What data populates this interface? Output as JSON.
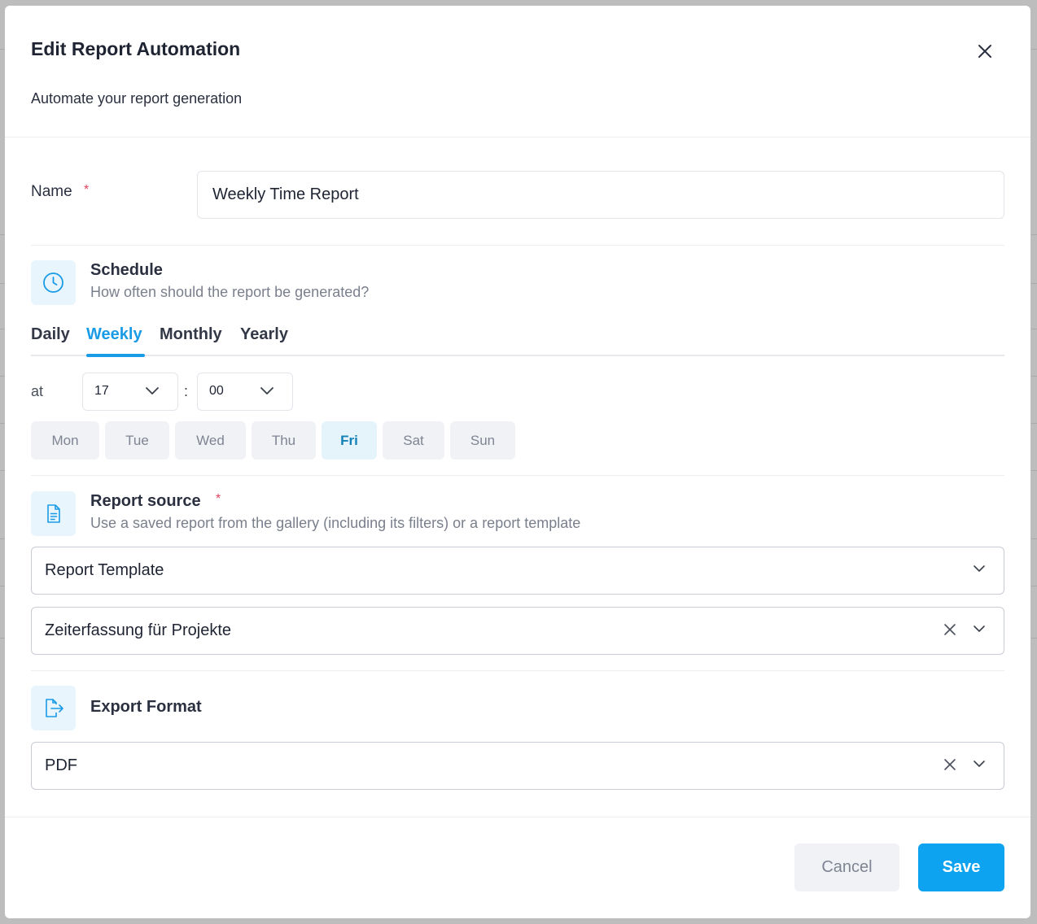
{
  "dialog": {
    "title": "Edit Report Automation",
    "subtitle": "Automate your report generation",
    "close_icon": "close-icon"
  },
  "name_field": {
    "label": "Name",
    "required_mark": "*",
    "value": "Weekly Time Report"
  },
  "schedule": {
    "icon": "clock-icon",
    "title": "Schedule",
    "description": "How often should the report be generated?",
    "tabs": [
      {
        "label": "Daily",
        "active": false
      },
      {
        "label": "Weekly",
        "active": true
      },
      {
        "label": "Monthly",
        "active": false
      },
      {
        "label": "Yearly",
        "active": false
      }
    ],
    "at_label": "at",
    "hour": "17",
    "separator": ":",
    "minute": "00",
    "days": [
      {
        "label": "Mon",
        "selected": false
      },
      {
        "label": "Tue",
        "selected": false
      },
      {
        "label": "Wed",
        "selected": false
      },
      {
        "label": "Thu",
        "selected": false
      },
      {
        "label": "Fri",
        "selected": true
      },
      {
        "label": "Sat",
        "selected": false
      },
      {
        "label": "Sun",
        "selected": false
      }
    ]
  },
  "report_source": {
    "icon": "document-icon",
    "title": "Report source",
    "required_mark": "*",
    "description": "Use a saved report from the gallery (including its filters) or a report template",
    "source_type": "Report Template",
    "template": "Zeiterfassung für Projekte"
  },
  "export_format": {
    "icon": "file-export-icon",
    "title": "Export Format",
    "value": "PDF"
  },
  "footer": {
    "cancel_label": "Cancel",
    "save_label": "Save"
  },
  "colors": {
    "accent": "#0ea3f0",
    "required": "#e0435c",
    "icon_bg": "#e8f5fc"
  }
}
